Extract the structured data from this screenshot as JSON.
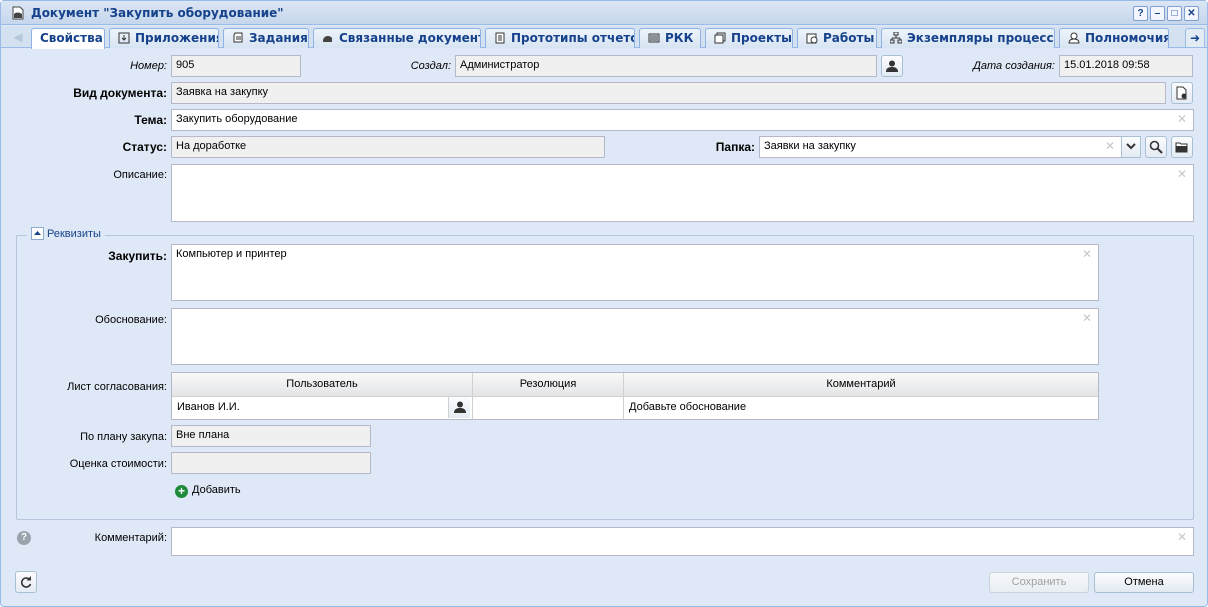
{
  "window": {
    "title": "Документ \"Закупить оборудование\"",
    "tools": [
      "?",
      "–",
      "□",
      "✕"
    ]
  },
  "tabs": [
    {
      "label": "Свойства",
      "icon": "none"
    },
    {
      "label": "Приложения",
      "icon": "attachment-icon"
    },
    {
      "label": "Задания",
      "icon": "task-icon"
    },
    {
      "label": "Связанные документы",
      "icon": "linked-docs-icon"
    },
    {
      "label": "Прототипы отчетов",
      "icon": "report-icon"
    },
    {
      "label": "РКК",
      "icon": "barcode-icon"
    },
    {
      "label": "Проекты",
      "icon": "projects-icon"
    },
    {
      "label": "Работы",
      "icon": "works-icon"
    },
    {
      "label": "Экземпляры процессов",
      "icon": "process-icon"
    },
    {
      "label": "Полномочия",
      "icon": "user-rights-icon"
    }
  ],
  "form": {
    "number_label": "Номер:",
    "number_value": "905",
    "created_by_label": "Создал:",
    "created_by_value": "Администратор",
    "created_date_label": "Дата создания:",
    "created_date_value": "15.01.2018 09:58",
    "doc_type_label": "Вид документа:",
    "doc_type_value": "Заявка на закупку",
    "subject_label": "Тема:",
    "subject_value": "Закупить оборудование",
    "status_label": "Статус:",
    "status_value": "На доработке",
    "folder_label": "Папка:",
    "folder_value": "Заявки на закупку",
    "description_label": "Описание:",
    "description_value": ""
  },
  "requisites": {
    "legend": "Реквизиты",
    "buy_label": "Закупить:",
    "buy_value": "Компьютер и принтер",
    "reason_label": "Обоснование:",
    "reason_value": "",
    "approval_label": "Лист согласования:",
    "columns": [
      "Пользователь",
      "Резолюция",
      "Комментарий"
    ],
    "rows": [
      {
        "user": "Иванов И.И.",
        "resolution": "",
        "comment": "Добавьте обоснование"
      }
    ],
    "plan_label": "По плану закупа:",
    "plan_value": "Вне плана",
    "cost_label": "Оценка стоимости:",
    "cost_value": "",
    "add_label": "Добавить"
  },
  "comment": {
    "label": "Комментарий:",
    "value": ""
  },
  "footer": {
    "save_label": "Сохранить",
    "cancel_label": "Отмена"
  }
}
